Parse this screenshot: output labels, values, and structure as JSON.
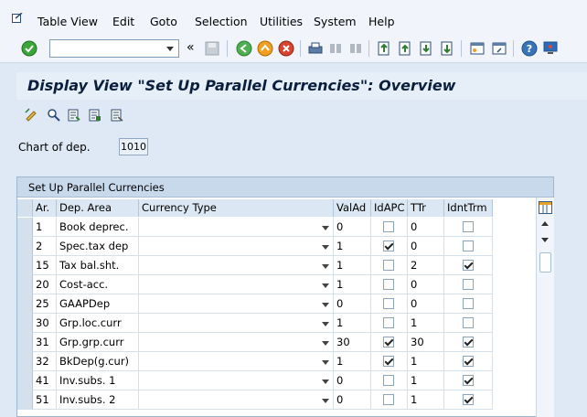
{
  "menu": {
    "items": [
      "Table View",
      "Edit",
      "Goto",
      "Selection",
      "Utilities",
      "System",
      "Help"
    ]
  },
  "toolbar": {
    "command_value": "",
    "history_glyph": "«",
    "icons": [
      "enter-icon",
      "save-icon",
      "back-icon",
      "exit-icon",
      "cancel-icon",
      "print-icon",
      "find-icon",
      "find-next-icon",
      "first-page-icon",
      "prev-page-icon",
      "next-page-icon",
      "last-page-icon",
      "create-session-icon",
      "shortcut-icon",
      "help-icon",
      "customize-icon"
    ]
  },
  "page": {
    "title": "Display View \"Set Up Parallel Currencies\": Overview"
  },
  "app_toolbar": {
    "icons": [
      "change-display-icon",
      "details-icon",
      "copy-icon",
      "delete-icon",
      "undo-icon"
    ]
  },
  "chart_of_dep": {
    "label": "Chart of dep.",
    "value": "1010"
  },
  "table": {
    "title": "Set Up Parallel Currencies",
    "columns": [
      "Ar.",
      "Dep. Area",
      "Currency Type",
      "ValAd",
      "IdAPC",
      "TTr",
      "IdntTrm"
    ],
    "rows": [
      {
        "ar": "1",
        "area": "Book deprec.",
        "currency": "",
        "valad": "0",
        "idapc": false,
        "ttr": "0",
        "idnttrm": false
      },
      {
        "ar": "2",
        "area": "Spec.tax dep",
        "currency": "",
        "valad": "1",
        "idapc": true,
        "ttr": "0",
        "idnttrm": false
      },
      {
        "ar": "15",
        "area": "Tax bal.sht.",
        "currency": "",
        "valad": "1",
        "idapc": false,
        "ttr": "2",
        "idnttrm": true
      },
      {
        "ar": "20",
        "area": "Cost-acc.",
        "currency": "",
        "valad": "1",
        "idapc": false,
        "ttr": "0",
        "idnttrm": false
      },
      {
        "ar": "25",
        "area": "GAAPDep",
        "currency": "",
        "valad": "0",
        "idapc": false,
        "ttr": "0",
        "idnttrm": false
      },
      {
        "ar": "30",
        "area": "Grp.loc.curr",
        "currency": "",
        "valad": "1",
        "idapc": false,
        "ttr": "1",
        "idnttrm": false
      },
      {
        "ar": "31",
        "area": "Grp.grp.curr",
        "currency": "",
        "valad": "30",
        "idapc": true,
        "ttr": "30",
        "idnttrm": true
      },
      {
        "ar": "32",
        "area": "BkDep(g.cur)",
        "currency": "",
        "valad": "1",
        "idapc": true,
        "ttr": "1",
        "idnttrm": true
      },
      {
        "ar": "41",
        "area": "Inv.subs. 1",
        "currency": "",
        "valad": "0",
        "idapc": false,
        "ttr": "1",
        "idnttrm": true
      },
      {
        "ar": "51",
        "area": "Inv.subs. 2",
        "currency": "",
        "valad": "0",
        "idapc": false,
        "ttr": "1",
        "idnttrm": true
      }
    ]
  },
  "colors": {
    "background": "#dfe9f5",
    "title_text": "#0a1f3d",
    "header_bg": "#dbe7f3"
  }
}
